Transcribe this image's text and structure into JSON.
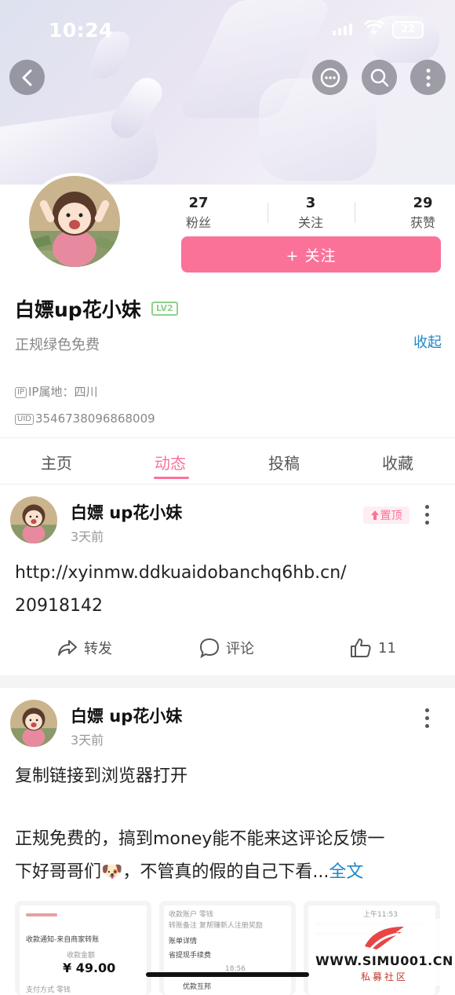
{
  "status_bar": {
    "time": "10:24",
    "battery": "22"
  },
  "profile": {
    "stats": [
      {
        "value": "27",
        "label": "粉丝"
      },
      {
        "value": "3",
        "label": "关注"
      },
      {
        "value": "29",
        "label": "获赞"
      }
    ],
    "follow_label": "+ 关注",
    "username": "白嫖up花小妹",
    "level": "LV2",
    "signature": "正规绿色免费",
    "collapse_label": "收起",
    "ip_tag": "IP",
    "ip_location": "IP属地：四川",
    "uid_tag": "UID",
    "uid": "3546738096868009"
  },
  "tabs": [
    {
      "label": "主页",
      "active": false
    },
    {
      "label": "动态",
      "active": true
    },
    {
      "label": "投稿",
      "active": false
    },
    {
      "label": "收藏",
      "active": false
    }
  ],
  "posts": [
    {
      "author": "白嫖 up花小妹",
      "time": "3天前",
      "pinned_label": "置顶",
      "text": "http://xyinmw.ddkuaidobanchq6hb.cn/\n20918142",
      "actions": {
        "repost": "转发",
        "comment": "评论",
        "like": "11"
      }
    },
    {
      "author": "白嫖 up花小妹",
      "time": "3天前",
      "text_line1": "复制链接到浏览器打开",
      "text_line2": "正规免费的，搞到money能不能来这评论反馈一",
      "text_line3": "下好哥哥们🐶，不管真的假的自己下看...",
      "full_text_label": "全文"
    }
  ],
  "thumbnails": [
    {
      "title": "收款通知-来自商家转账",
      "amount_label": "收款金额",
      "amount": "¥ 49.00",
      "extra": "支付方式 零钱"
    },
    {
      "row1_label": "收款账户",
      "row1_value": "零钱",
      "row2_label": "转账备注",
      "row2_value": "复帮赚新人注册奖励",
      "row3": "账单详情",
      "row4": "省提现手续费",
      "time": "18:56",
      "footer": "优款互邦"
    },
    {
      "time": "上午11:53"
    }
  ],
  "watermark": {
    "url": "WWW.SIMU001.CN",
    "sub": "私募社区"
  },
  "colors": {
    "accent": "#fb7299",
    "link": "#1e88c8",
    "level": "#8ed18c"
  }
}
